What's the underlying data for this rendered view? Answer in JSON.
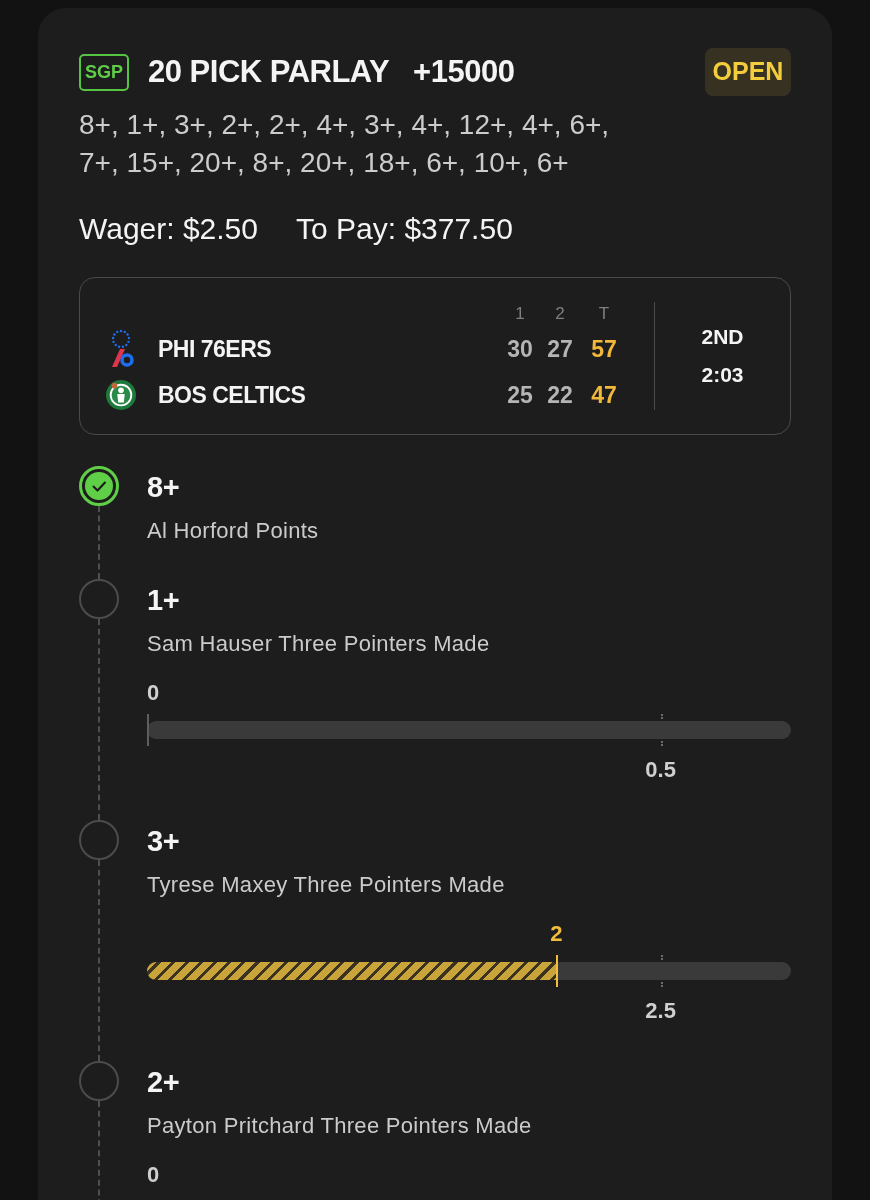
{
  "bet": {
    "badge": "SGP",
    "title": "20 PICK PARLAY",
    "odds": "+15000",
    "status": "OPEN",
    "legs_summary": "8+, 1+, 3+, 2+, 2+, 4+, 3+, 4+, 12+, 4+, 6+, 7+, 15+, 20+, 8+, 20+, 18+, 6+, 10+, 6+",
    "wager": "Wager: $2.50",
    "to_pay": "To Pay: $377.50"
  },
  "scoreboard": {
    "columns": [
      "1",
      "2",
      "T"
    ],
    "teams": [
      {
        "name": "PHI 76ERS",
        "scores": [
          "30",
          "27"
        ],
        "total": "57"
      },
      {
        "name": "BOS CELTICS",
        "scores": [
          "25",
          "22"
        ],
        "total": "47"
      }
    ],
    "period": "2ND",
    "clock": "2:03"
  },
  "legs": [
    {
      "line": "8+",
      "description": "Al Horford Points",
      "checked": true
    },
    {
      "line": "1+",
      "description": "Sam Hauser Three Pointers Made",
      "checked": false,
      "progress": {
        "current": "0",
        "level": 0,
        "target": "0.5"
      }
    },
    {
      "line": "3+",
      "description": "Tyrese Maxey Three Pointers Made",
      "checked": false,
      "progress": {
        "current": "2",
        "level": 0.637,
        "target": "2.5"
      }
    },
    {
      "line": "2+",
      "description": "Payton Pritchard Three Pointers Made",
      "checked": false,
      "progress": {
        "current": "0"
      }
    }
  ]
}
